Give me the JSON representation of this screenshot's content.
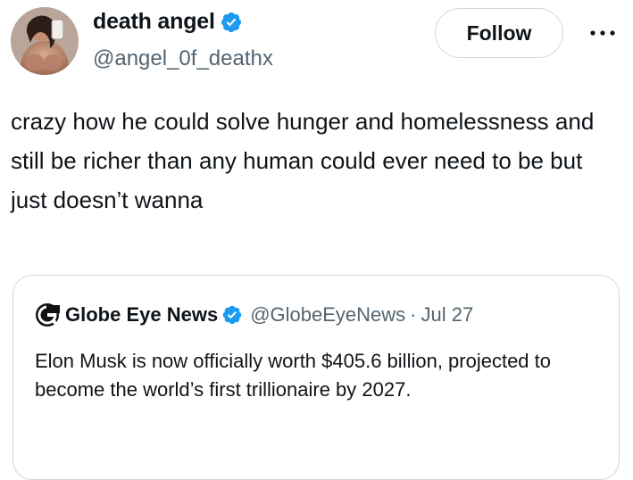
{
  "author": {
    "display_name": "death angel",
    "handle": "@angel_0f_deathx",
    "verified": true,
    "avatar_icon": "profile-photo"
  },
  "actions": {
    "follow_label": "Follow",
    "more_icon": "more-horizontal-icon"
  },
  "tweet": {
    "text": "crazy how he could solve hunger and homelessness and still be richer than any human could ever need to be but just doesn’t wanna"
  },
  "quoted_tweet": {
    "display_name": "Globe Eye News",
    "handle": "@GlobeEyeNews",
    "separator": "·",
    "date": "Jul 27",
    "verified": true,
    "logo_icon": "globe-eye-logo",
    "text": "Elon Musk is now officially worth $405.6 billion, projected to become the world’s first trillionaire by 2027."
  },
  "colors": {
    "verified_blue": "#1d9bf0",
    "text_primary": "#0f1419",
    "text_secondary": "#536471",
    "border": "#cfd9de"
  }
}
